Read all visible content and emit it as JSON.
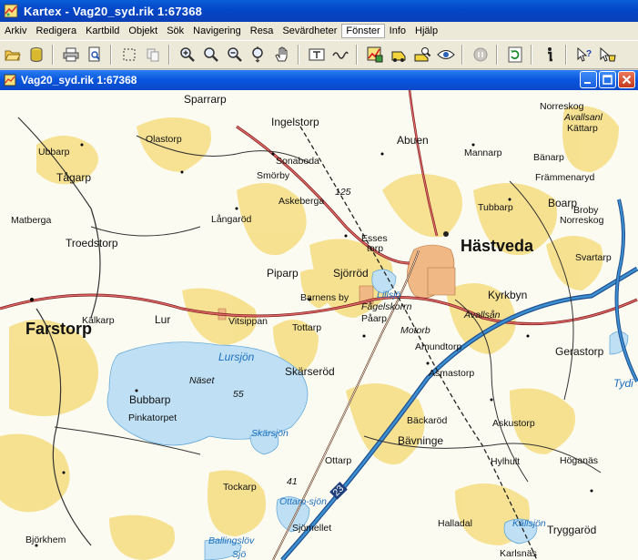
{
  "app": {
    "title": "Kartex - Vag20_syd.rik 1:67368"
  },
  "menu": {
    "items": [
      "Arkiv",
      "Redigera",
      "Kartbild",
      "Objekt",
      "Sök",
      "Navigering",
      "Resa",
      "Sevärdheter",
      "Fönster",
      "Info",
      "Hjälp"
    ],
    "active": "Fönster"
  },
  "toolbar": {
    "buttons": [
      "open-icon",
      "database-icon",
      "print-icon",
      "print-preview-icon",
      "select-rect-icon",
      "copy-icon",
      "zoom-in-icon",
      "zoom-icon",
      "zoom-out-icon",
      "zoom-fit-icon",
      "pan-hand-icon",
      "text-icon",
      "road-icon",
      "layers-icon",
      "vehicle-icon",
      "vehicle-search-icon",
      "view-icon",
      "disabled-icon",
      "refresh-icon",
      "info-icon",
      "help-icon",
      "help-pointer-icon"
    ]
  },
  "document": {
    "title": "Vag20_syd.rik 1:67368"
  },
  "map": {
    "places": {
      "sparrarp": "Sparrarp",
      "ingelstorp": "Ingelstorp",
      "abuen": "Abuen",
      "norreskog": "Norreskog",
      "avallsanl": "Avallsanl",
      "olastorp": "Olastorp",
      "ubbarp": "Ubbarp",
      "mannarp": "Mannarp",
      "kattarp": "Kättarp",
      "banarp": "Bänarp",
      "sonaboda": "Sonaboda",
      "tagarp": "Tågarp",
      "smorby": "Smörby",
      "frammenarod": "Främmenaryd",
      "askeberga": "Askeberga",
      "num125": "125",
      "tubbarp": "Tubbarp",
      "boarp": "Boarp",
      "matberga": "Matberga",
      "langarod": "Långaröd",
      "broby": "Broby",
      "norreskog2": "Norreskog",
      "esses": "Esses",
      "torp": "torp",
      "hastveda": "Hästveda",
      "troedstorp": "Troedstorp",
      "svartarp": "Svartarp",
      "piparp": "Piparp",
      "sjorrod": "Sjörröd",
      "barnens": "Barnens by",
      "lillsjo": "Lillsjö",
      "fagelsk": "Fågelskorrn",
      "kyrkbyn": "Kyrkbyn",
      "farstorp": "Farstorp",
      "kalkarp": "Kälkarp",
      "lur": "Lur",
      "vitsippan": "Vitsippan",
      "tottarp": "Tottarp",
      "paarp": "Påarp",
      "avallsan": "Avallsån",
      "motorb": "Motorb",
      "amundtorp": "Amundtorp",
      "gerastorp": "Gerastorp",
      "lursjon": "Lursjön",
      "naset": "Näset",
      "skarserod": "Skärseröd",
      "asmastorp": "Asmastorp",
      "num55": "55",
      "tydi": "Tydi",
      "bubbarp": "Bubbarp",
      "pinkatorpet": "Pinkatorpet",
      "backarod": "Bäckaröd",
      "askustorp": "Askustorp",
      "skarsjon": "Skärsjön",
      "bavninge": "Bävninge",
      "ottarp": "Ottarp",
      "hylhult": "Hylhult",
      "haganas": "Höganäs",
      "num41": "41",
      "tockarp": "Tockarp",
      "ottarpsjon": "Ottarp-sjön",
      "num23": "23",
      "sjomellet": "Sjömellet",
      "halladal": "Halladal",
      "kallsjon": "Källsjön",
      "tryggarod": "Tryggaröd",
      "bjorkhem": "Björkhem",
      "ballingslov": "Ballingslöv",
      "karlsnas": "Karlsnäs",
      "sjo2": "Sjö"
    }
  }
}
